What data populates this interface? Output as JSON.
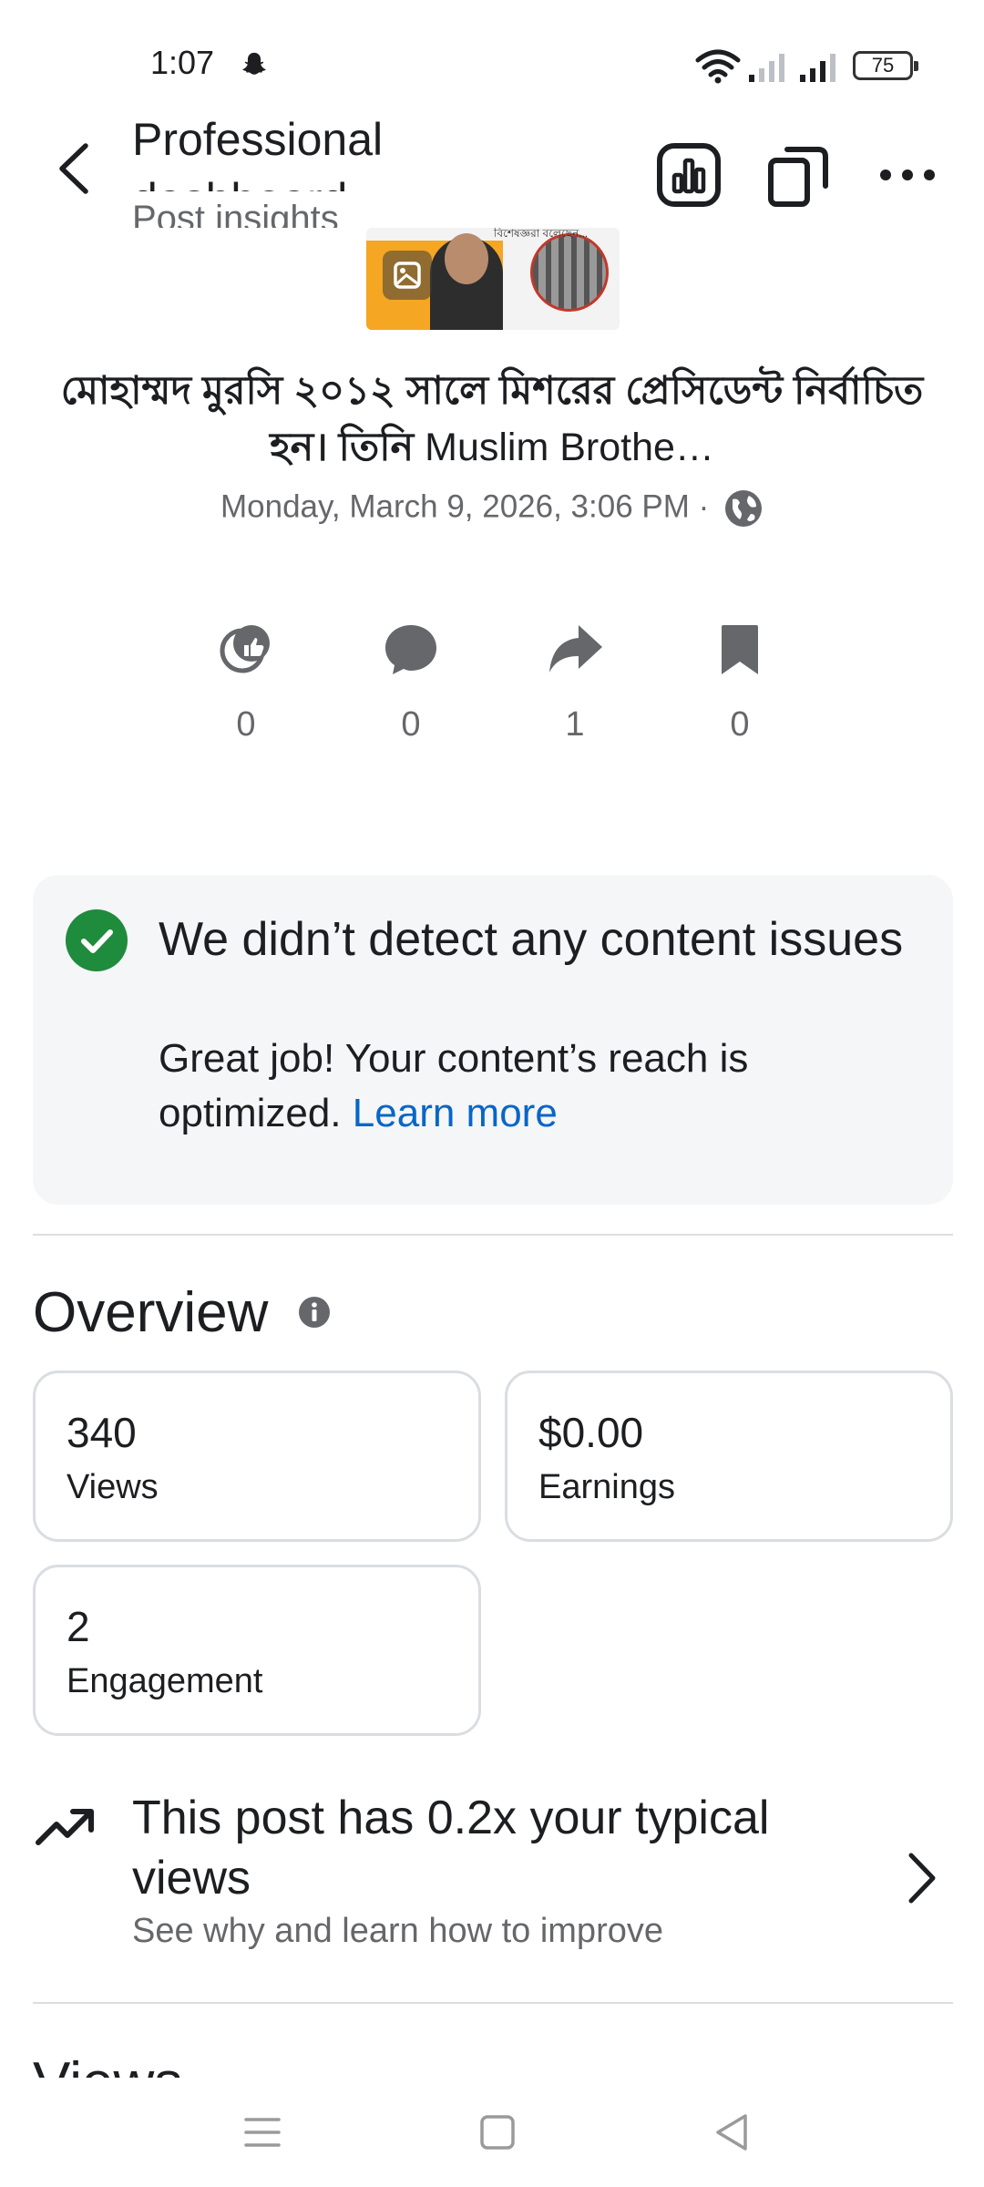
{
  "status_bar": {
    "time": "1:07",
    "battery": "75"
  },
  "header": {
    "title": "Professional dashboard",
    "subtitle": "Post insights"
  },
  "post": {
    "text_bengali": "মোহাম্মদ মুরসি ২০১২ সালে মিশরের প্রেসিডেন্ট নির্বাচিত হন। তিনি",
    "text_latin": " Muslim Brothe…",
    "date": "Monday, March 9, 2026, 3:06 PM ·",
    "thumbnail_caption": "বিশেষজ্ঞরা বলেছেন..."
  },
  "stats": {
    "reactions": "0",
    "comments": "0",
    "shares": "1",
    "saves": "0"
  },
  "content_issues": {
    "title": "We didn’t detect any content issues",
    "description": "Great job! Your content’s reach is optimized.",
    "link": "Learn more"
  },
  "overview": {
    "title": "Overview",
    "cards": [
      {
        "value": "340",
        "label": "Views"
      },
      {
        "value": "$0.00",
        "label": "Earnings"
      },
      {
        "value": "2",
        "label": "Engagement"
      }
    ]
  },
  "typical": {
    "title": "This post has 0.2x your typical views",
    "subtitle": "See why and learn how to improve"
  },
  "next_section": {
    "title": "Views"
  },
  "colors": {
    "accent_link": "#0866c6",
    "success_green": "#1f8b3d",
    "card_bg": "#f5f6f8",
    "secondary_text": "#65676b"
  }
}
